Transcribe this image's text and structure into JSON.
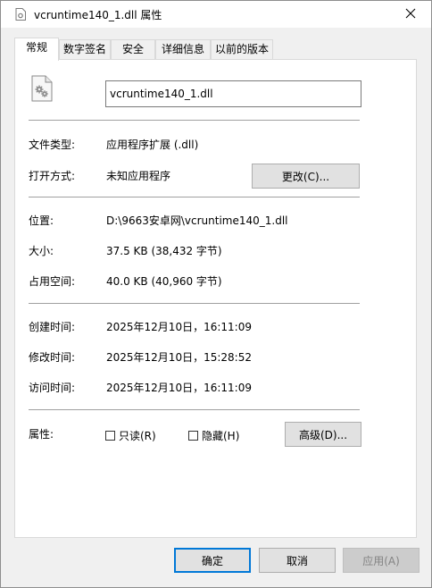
{
  "window": {
    "title": "vcruntime140_1.dll 属性",
    "close_icon": "close-icon"
  },
  "tabs": [
    {
      "label": "常规",
      "active": true
    },
    {
      "label": "数字签名",
      "active": false
    },
    {
      "label": "安全",
      "active": false
    },
    {
      "label": "详细信息",
      "active": false
    },
    {
      "label": "以前的版本",
      "active": false
    }
  ],
  "general": {
    "file_icon": "settings-file-icon",
    "file_name": "vcruntime140_1.dll",
    "file_type_label": "文件类型:",
    "file_type_value": "应用程序扩展 (.dll)",
    "opens_with_label": "打开方式:",
    "opens_with_value": "未知应用程序",
    "change_button": "更改(C)...",
    "location_label": "位置:",
    "location_value": "D:\\9663安卓网\\vcruntime140_1.dll",
    "size_label": "大小:",
    "size_value": "37.5 KB (38,432 字节)",
    "size_on_disk_label": "占用空间:",
    "size_on_disk_value": "40.0 KB (40,960 字节)",
    "created_label": "创建时间:",
    "created_value": "2025年12月10日，16:11:09",
    "modified_label": "修改时间:",
    "modified_value": "2025年12月10日，15:28:52",
    "accessed_label": "访问时间:",
    "accessed_value": "2025年12月10日，16:11:09",
    "attributes_label": "属性:",
    "readonly_label": "只读(R)",
    "readonly_checked": false,
    "hidden_label": "隐藏(H)",
    "hidden_checked": false,
    "advanced_button": "高级(D)..."
  },
  "footer": {
    "ok_button": "确定",
    "cancel_button": "取消",
    "apply_button": "应用(A)"
  },
  "colors": {
    "focus_border": "#0078d7",
    "panel_background": "#ffffff",
    "window_background": "#f0f0f0"
  }
}
